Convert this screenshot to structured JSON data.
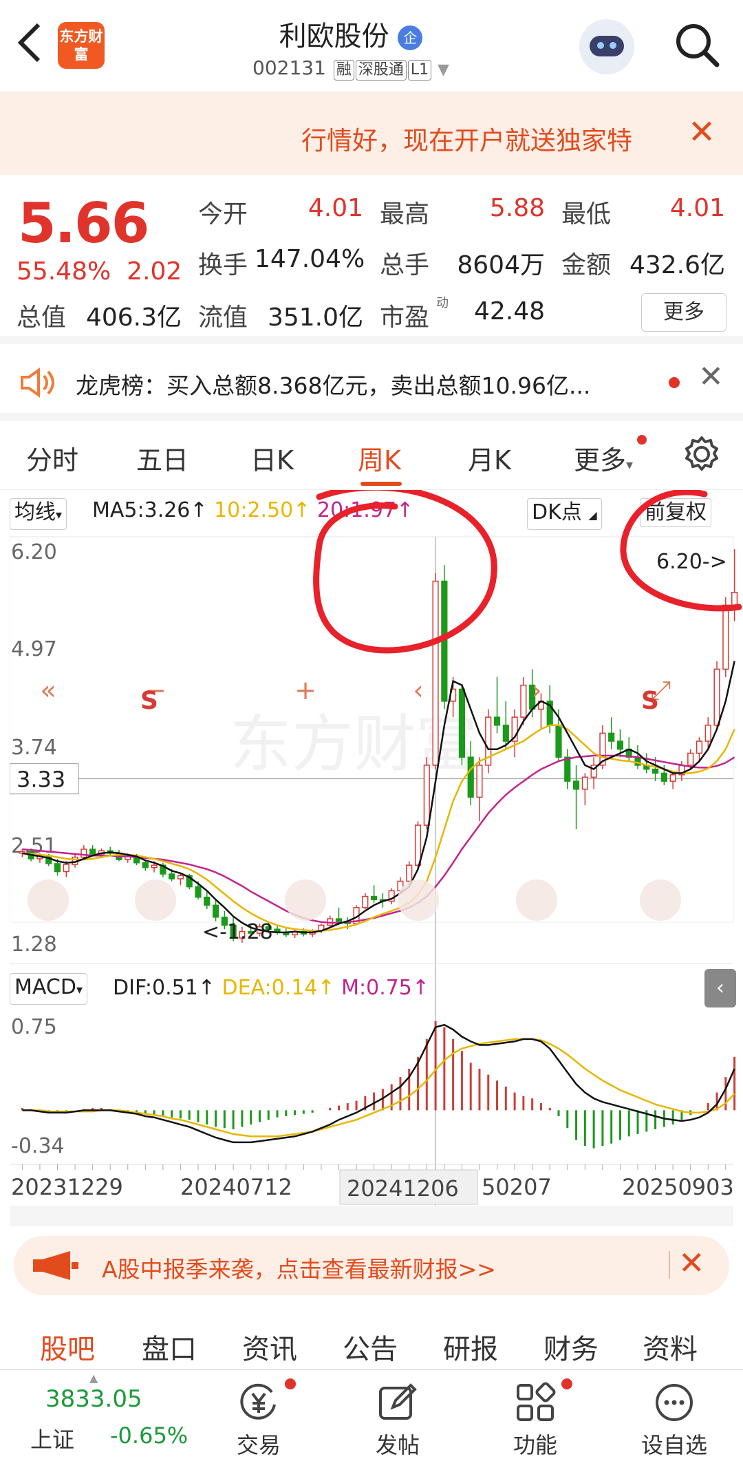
{
  "header": {
    "back_icon": "chevron-left-icon",
    "logo_text": "东方财富",
    "stock_name": "利欧股份",
    "badge": "企",
    "code": "002131",
    "tags": [
      "融",
      "深股通",
      "L1"
    ]
  },
  "promo_banner": {
    "text": "行情好，现在开户就送独家特"
  },
  "quote": {
    "price": "5.66",
    "change_pct": "55.48%",
    "change": "2.02",
    "rows": [
      [
        {
          "label": "今开",
          "value": "4.01",
          "red": true
        },
        {
          "label": "最高",
          "value": "5.88",
          "red": true
        },
        {
          "label": "最低",
          "value": "4.01",
          "red": true
        }
      ],
      [
        {
          "label": "换手",
          "value": "147.04%"
        },
        {
          "label": "总手",
          "value": "8604万"
        },
        {
          "label": "金额",
          "value": "432.6亿"
        }
      ],
      [
        {
          "label": "总值",
          "value": "406.3亿"
        },
        {
          "label": "流值",
          "value": "351.0亿"
        },
        {
          "label": "市盈",
          "value": "42.48",
          "sup": "动"
        }
      ]
    ],
    "more_label": "更多"
  },
  "dragon_tiger": {
    "text": "龙虎榜：买入总额8.368亿元，卖出总额10.96亿..."
  },
  "chart_tabs": [
    "分时",
    "五日",
    "日K",
    "周K",
    "月K",
    "更多"
  ],
  "chart_header": {
    "ma_select": "均线",
    "ma5": "MA5:3.26↑",
    "ma10": "10:2.50↑",
    "ma20": "20:1.97↑",
    "dk_select": "DK点",
    "adjust": "前复权"
  },
  "macd_header": {
    "select": "MACD",
    "dif": "DIF:0.51↑",
    "dea": "DEA:0.14↑",
    "m": "M:0.75↑"
  },
  "chart_data": [
    {
      "type": "candlestick",
      "ylim": [
        1.28,
        6.2
      ],
      "y_ticks": [
        "6.20",
        "4.97",
        "3.74",
        "2.51",
        "1.28"
      ],
      "crosshair_value": "3.33",
      "max_label": "6.20->",
      "min_label": "<-1.28",
      "watermark": "东方财富",
      "x_tick_labels": [
        "20231229",
        "20240712",
        "20241206",
        "20250207",
        "20250903"
      ],
      "crosshair_x_label": "20241206",
      "visible_partial_x_label": "50207",
      "candles": [
        [
          2.4,
          2.45,
          2.35,
          2.42
        ],
        [
          2.42,
          2.46,
          2.3,
          2.33
        ],
        [
          2.33,
          2.4,
          2.28,
          2.37
        ],
        [
          2.37,
          2.39,
          2.24,
          2.27
        ],
        [
          2.27,
          2.33,
          2.12,
          2.17
        ],
        [
          2.17,
          2.3,
          2.1,
          2.26
        ],
        [
          2.26,
          2.38,
          2.22,
          2.35
        ],
        [
          2.35,
          2.5,
          2.33,
          2.45
        ],
        [
          2.45,
          2.5,
          2.36,
          2.39
        ],
        [
          2.39,
          2.46,
          2.35,
          2.43
        ],
        [
          2.43,
          2.48,
          2.38,
          2.4
        ],
        [
          2.4,
          2.44,
          2.3,
          2.32
        ],
        [
          2.32,
          2.4,
          2.28,
          2.36
        ],
        [
          2.36,
          2.39,
          2.25,
          2.28
        ],
        [
          2.28,
          2.32,
          2.18,
          2.22
        ],
        [
          2.22,
          2.3,
          2.16,
          2.25
        ],
        [
          2.25,
          2.28,
          2.1,
          2.14
        ],
        [
          2.14,
          2.2,
          2.05,
          2.08
        ],
        [
          2.08,
          2.15,
          2.0,
          2.12
        ],
        [
          2.12,
          2.14,
          1.95,
          1.98
        ],
        [
          1.98,
          2.05,
          1.82,
          1.85
        ],
        [
          1.85,
          1.92,
          1.7,
          1.75
        ],
        [
          1.75,
          1.82,
          1.55,
          1.6
        ],
        [
          1.6,
          1.68,
          1.45,
          1.5
        ],
        [
          1.5,
          1.6,
          1.3,
          1.34
        ],
        [
          1.34,
          1.48,
          1.28,
          1.42
        ],
        [
          1.42,
          1.5,
          1.36,
          1.4
        ],
        [
          1.4,
          1.52,
          1.36,
          1.48
        ],
        [
          1.48,
          1.55,
          1.4,
          1.45
        ],
        [
          1.45,
          1.5,
          1.38,
          1.41
        ],
        [
          1.41,
          1.46,
          1.35,
          1.38
        ],
        [
          1.38,
          1.44,
          1.34,
          1.42
        ],
        [
          1.42,
          1.46,
          1.36,
          1.39
        ],
        [
          1.39,
          1.45,
          1.35,
          1.43
        ],
        [
          1.43,
          1.52,
          1.4,
          1.5
        ],
        [
          1.5,
          1.62,
          1.46,
          1.58
        ],
        [
          1.58,
          1.72,
          1.5,
          1.55
        ],
        [
          1.55,
          1.6,
          1.45,
          1.52
        ],
        [
          1.52,
          1.75,
          1.5,
          1.72
        ],
        [
          1.72,
          1.9,
          1.7,
          1.86
        ],
        [
          1.86,
          2.0,
          1.78,
          1.82
        ],
        [
          1.82,
          1.9,
          1.72,
          1.8
        ],
        [
          1.8,
          1.96,
          1.76,
          1.93
        ],
        [
          1.93,
          2.1,
          1.9,
          2.05
        ],
        [
          2.05,
          2.3,
          2.0,
          2.25
        ],
        [
          2.25,
          2.8,
          2.2,
          2.75
        ],
        [
          2.75,
          3.6,
          2.7,
          3.5
        ],
        [
          3.5,
          5.9,
          3.45,
          5.8
        ],
        [
          5.8,
          6.0,
          4.2,
          4.3
        ],
        [
          4.3,
          4.6,
          4.1,
          4.45
        ],
        [
          4.45,
          4.5,
          3.5,
          3.6
        ],
        [
          3.6,
          3.8,
          3.0,
          3.1
        ],
        [
          3.1,
          3.6,
          2.8,
          3.5
        ],
        [
          3.5,
          4.2,
          3.4,
          4.1
        ],
        [
          4.1,
          4.6,
          3.9,
          4.0
        ],
        [
          4.0,
          4.3,
          3.7,
          3.8
        ],
        [
          3.8,
          4.2,
          3.6,
          4.1
        ],
        [
          4.1,
          4.6,
          4.0,
          4.5
        ],
        [
          4.5,
          4.7,
          4.1,
          4.2
        ],
        [
          4.2,
          4.4,
          3.95,
          4.3
        ],
        [
          4.3,
          4.5,
          3.9,
          4.0
        ],
        [
          4.0,
          4.2,
          3.55,
          3.6
        ],
        [
          3.6,
          3.7,
          3.2,
          3.3
        ],
        [
          3.3,
          3.5,
          2.7,
          3.2
        ],
        [
          3.2,
          3.4,
          3.0,
          3.35
        ],
        [
          3.35,
          3.6,
          3.2,
          3.5
        ],
        [
          3.5,
          4.0,
          3.45,
          3.9
        ],
        [
          3.9,
          4.1,
          3.7,
          3.8
        ],
        [
          3.8,
          3.95,
          3.6,
          3.7
        ],
        [
          3.7,
          3.85,
          3.55,
          3.6
        ],
        [
          3.6,
          3.75,
          3.45,
          3.5
        ],
        [
          3.5,
          3.65,
          3.4,
          3.45
        ],
        [
          3.45,
          3.6,
          3.3,
          3.4
        ],
        [
          3.4,
          3.5,
          3.25,
          3.3
        ],
        [
          3.3,
          3.42,
          3.2,
          3.38
        ],
        [
          3.38,
          3.55,
          3.3,
          3.5
        ],
        [
          3.5,
          3.7,
          3.45,
          3.65
        ],
        [
          3.65,
          3.85,
          3.55,
          3.8
        ],
        [
          3.8,
          4.1,
          3.7,
          4.0
        ],
        [
          4.0,
          4.8,
          3.95,
          4.7
        ],
        [
          4.7,
          5.6,
          4.6,
          5.5
        ],
        [
          5.5,
          6.2,
          5.3,
          5.66
        ]
      ],
      "ma5_values": [
        2.4,
        2.38,
        2.36,
        2.34,
        2.3,
        2.28,
        2.29,
        2.33,
        2.37,
        2.4,
        2.41,
        2.4,
        2.38,
        2.36,
        2.31,
        2.28,
        2.24,
        2.18,
        2.15,
        2.1,
        2.02,
        1.93,
        1.82,
        1.72,
        1.61,
        1.53,
        1.47,
        1.44,
        1.42,
        1.41,
        1.41,
        1.42,
        1.41,
        1.41,
        1.43,
        1.47,
        1.52,
        1.55,
        1.6,
        1.68,
        1.75,
        1.8,
        1.83,
        1.9,
        1.98,
        2.2,
        2.6,
        3.3,
        4.0,
        4.55,
        4.5,
        4.2,
        3.9,
        3.7,
        3.7,
        3.75,
        3.85,
        4.05,
        4.2,
        4.3,
        4.25,
        4.1,
        3.9,
        3.7,
        3.5,
        3.45,
        3.55,
        3.6,
        3.65,
        3.7,
        3.65,
        3.55,
        3.5,
        3.45,
        3.4,
        3.4,
        3.45,
        3.55,
        3.7,
        3.95,
        4.3,
        4.8
      ],
      "ma10_values": [
        2.4,
        2.39,
        2.38,
        2.37,
        2.35,
        2.33,
        2.32,
        2.32,
        2.33,
        2.35,
        2.37,
        2.38,
        2.38,
        2.37,
        2.35,
        2.33,
        2.3,
        2.27,
        2.24,
        2.2,
        2.14,
        2.07,
        1.98,
        1.89,
        1.8,
        1.72,
        1.65,
        1.59,
        1.54,
        1.5,
        1.47,
        1.45,
        1.44,
        1.43,
        1.43,
        1.44,
        1.46,
        1.48,
        1.51,
        1.55,
        1.6,
        1.64,
        1.68,
        1.72,
        1.78,
        1.88,
        2.05,
        2.35,
        2.7,
        3.05,
        3.3,
        3.45,
        3.55,
        3.6,
        3.65,
        3.7,
        3.75,
        3.8,
        3.88,
        3.95,
        4.0,
        4.0,
        3.95,
        3.85,
        3.75,
        3.65,
        3.6,
        3.58,
        3.56,
        3.55,
        3.53,
        3.5,
        3.48,
        3.45,
        3.42,
        3.4,
        3.4,
        3.42,
        3.46,
        3.55,
        3.7,
        3.95
      ],
      "ma20_values": [
        2.45,
        2.44,
        2.43,
        2.42,
        2.41,
        2.4,
        2.39,
        2.38,
        2.37,
        2.37,
        2.37,
        2.36,
        2.36,
        2.35,
        2.34,
        2.33,
        2.32,
        2.3,
        2.28,
        2.26,
        2.23,
        2.2,
        2.16,
        2.11,
        2.05,
        1.99,
        1.92,
        1.86,
        1.8,
        1.74,
        1.68,
        1.63,
        1.59,
        1.56,
        1.54,
        1.53,
        1.53,
        1.54,
        1.55,
        1.57,
        1.59,
        1.62,
        1.65,
        1.68,
        1.72,
        1.78,
        1.86,
        1.98,
        2.12,
        2.28,
        2.45,
        2.6,
        2.75,
        2.9,
        3.02,
        3.13,
        3.22,
        3.3,
        3.38,
        3.45,
        3.5,
        3.55,
        3.58,
        3.6,
        3.61,
        3.62,
        3.62,
        3.62,
        3.62,
        3.61,
        3.6,
        3.58,
        3.56,
        3.54,
        3.52,
        3.5,
        3.48,
        3.47,
        3.47,
        3.49,
        3.53,
        3.6
      ]
    },
    {
      "type": "macd",
      "ylim": [
        -0.34,
        0.75
      ],
      "y_ticks": [
        "0.75",
        "-0.34"
      ],
      "bars": [
        0.02,
        0.01,
        0.0,
        -0.01,
        -0.02,
        -0.01,
        0.0,
        0.01,
        0.02,
        0.02,
        0.01,
        0.0,
        -0.01,
        -0.02,
        -0.03,
        -0.04,
        -0.05,
        -0.06,
        -0.07,
        -0.08,
        -0.1,
        -0.12,
        -0.14,
        -0.15,
        -0.16,
        -0.14,
        -0.12,
        -0.1,
        -0.08,
        -0.06,
        -0.05,
        -0.04,
        -0.03,
        -0.02,
        0.0,
        0.02,
        0.04,
        0.06,
        0.08,
        0.12,
        0.15,
        0.18,
        0.22,
        0.28,
        0.35,
        0.45,
        0.6,
        0.75,
        0.7,
        0.6,
        0.5,
        0.4,
        0.35,
        0.3,
        0.25,
        0.2,
        0.15,
        0.12,
        0.1,
        0.06,
        0.02,
        -0.05,
        -0.15,
        -0.25,
        -0.3,
        -0.32,
        -0.3,
        -0.28,
        -0.25,
        -0.22,
        -0.2,
        -0.18,
        -0.16,
        -0.14,
        -0.12,
        -0.08,
        -0.04,
        0.0,
        0.06,
        0.15,
        0.28,
        0.45
      ],
      "dif": [
        0.0,
        0.0,
        -0.01,
        -0.02,
        -0.02,
        -0.02,
        -0.01,
        0.0,
        0.0,
        0.0,
        0.0,
        -0.01,
        -0.02,
        -0.03,
        -0.05,
        -0.06,
        -0.08,
        -0.1,
        -0.12,
        -0.14,
        -0.17,
        -0.2,
        -0.23,
        -0.25,
        -0.27,
        -0.27,
        -0.27,
        -0.26,
        -0.25,
        -0.24,
        -0.23,
        -0.22,
        -0.2,
        -0.18,
        -0.15,
        -0.12,
        -0.08,
        -0.05,
        -0.02,
        0.02,
        0.06,
        0.1,
        0.15,
        0.2,
        0.28,
        0.4,
        0.55,
        0.7,
        0.72,
        0.68,
        0.62,
        0.58,
        0.55,
        0.55,
        0.56,
        0.57,
        0.58,
        0.6,
        0.6,
        0.58,
        0.52,
        0.42,
        0.32,
        0.22,
        0.15,
        0.1,
        0.07,
        0.05,
        0.03,
        0.01,
        -0.01,
        -0.03,
        -0.05,
        -0.07,
        -0.08,
        -0.09,
        -0.08,
        -0.06,
        -0.02,
        0.05,
        0.18,
        0.35
      ],
      "dea": [
        0.0,
        0.0,
        0.0,
        -0.01,
        -0.01,
        -0.01,
        -0.01,
        -0.01,
        -0.01,
        0.0,
        0.0,
        0.0,
        -0.01,
        -0.02,
        -0.03,
        -0.04,
        -0.05,
        -0.07,
        -0.08,
        -0.1,
        -0.12,
        -0.14,
        -0.16,
        -0.18,
        -0.2,
        -0.21,
        -0.22,
        -0.22,
        -0.22,
        -0.22,
        -0.21,
        -0.2,
        -0.19,
        -0.18,
        -0.16,
        -0.14,
        -0.12,
        -0.1,
        -0.08,
        -0.05,
        -0.02,
        0.01,
        0.04,
        0.08,
        0.12,
        0.18,
        0.25,
        0.34,
        0.42,
        0.48,
        0.52,
        0.54,
        0.56,
        0.57,
        0.58,
        0.59,
        0.6,
        0.6,
        0.6,
        0.59,
        0.56,
        0.52,
        0.47,
        0.41,
        0.35,
        0.3,
        0.25,
        0.21,
        0.17,
        0.14,
        0.11,
        0.08,
        0.05,
        0.03,
        0.01,
        -0.01,
        -0.02,
        -0.02,
        -0.01,
        0.01,
        0.06,
        0.14
      ]
    }
  ],
  "promo_bar": {
    "text": "A股中报季来袭，点击查看最新财报>>"
  },
  "sub_tabs": [
    "股吧",
    "盘口",
    "资讯",
    "公告",
    "研报",
    "财务",
    "资料"
  ],
  "bottom_bar": {
    "index_value": "3833.05",
    "index_name": "上证",
    "index_change": "-0.65%",
    "items": [
      "交易",
      "发帖",
      "功能",
      "设自选"
    ]
  }
}
